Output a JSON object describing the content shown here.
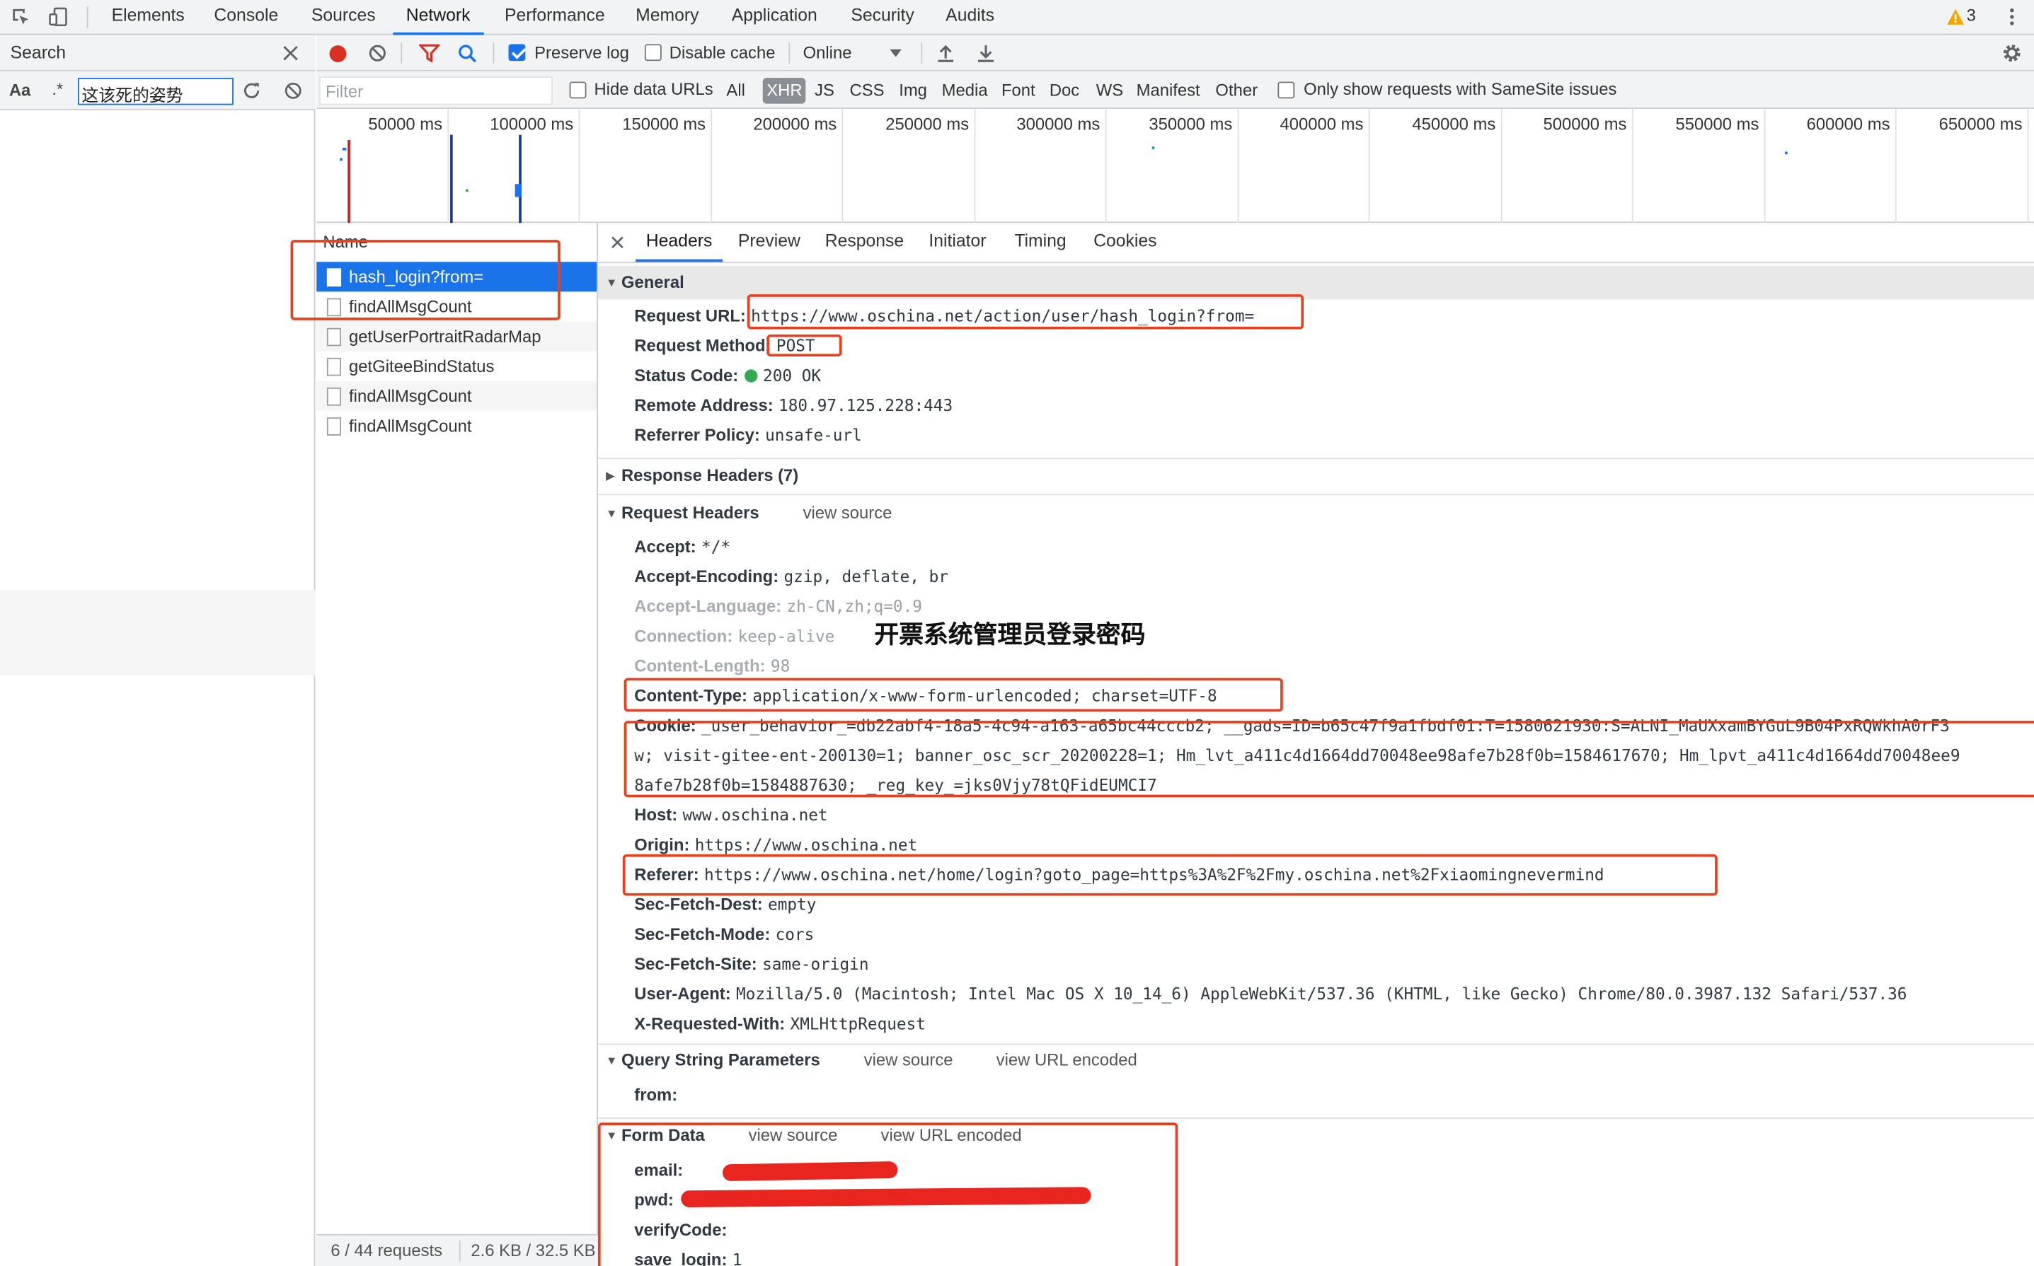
{
  "devtools": {
    "tabs": [
      "Elements",
      "Console",
      "Sources",
      "Network",
      "Performance",
      "Memory",
      "Application",
      "Security",
      "Audits"
    ],
    "active_tab": "Network",
    "warning_count": "3"
  },
  "search": {
    "title": "Search",
    "case_label": "Aa",
    "regex_label": ".*",
    "query": "这该死的姿势"
  },
  "network_toolbar": {
    "preserve_log": "Preserve log",
    "disable_cache": "Disable cache",
    "throttle": "Online"
  },
  "filter_bar": {
    "placeholder": "Filter",
    "hide_data_urls": "Hide data URLs",
    "types": [
      "All",
      "XHR",
      "JS",
      "CSS",
      "Img",
      "Media",
      "Font",
      "Doc",
      "WS",
      "Manifest",
      "Other"
    ],
    "selected_type": "XHR",
    "samesite": "Only show requests with SameSite issues"
  },
  "timeline": {
    "ticks": [
      "50000 ms",
      "100000 ms",
      "150000 ms",
      "200000 ms",
      "250000 ms",
      "300000 ms",
      "350000 ms",
      "400000 ms",
      "450000 ms",
      "500000 ms",
      "550000 ms",
      "600000 ms",
      "650000 ms"
    ]
  },
  "requests": {
    "header": "Name",
    "items": [
      "hash_login?from=",
      "findAllMsgCount",
      "getUserPortraitRadarMap",
      "getGiteeBindStatus",
      "findAllMsgCount",
      "findAllMsgCount"
    ],
    "status_count": "6 / 44 requests",
    "status_size": "2.6 KB / 32.5 KB"
  },
  "detail": {
    "tabs": [
      "Headers",
      "Preview",
      "Response",
      "Initiator",
      "Timing",
      "Cookies"
    ],
    "active_tab": "Headers",
    "general": {
      "title": "General",
      "request_url_k": "Request URL:",
      "request_url_v": "https://www.oschina.net/action/user/hash_login?from=",
      "method_k": "Request Method:",
      "method_v": "POST",
      "status_k": "Status Code:",
      "status_v": "200 OK",
      "remote_k": "Remote Address:",
      "remote_v": "180.97.125.228:443",
      "referrer_k": "Referrer Policy:",
      "referrer_v": "unsafe-url"
    },
    "response_headers": "Response Headers (7)",
    "request_headers": {
      "title": "Request Headers",
      "view_source": "view source",
      "accept_k": "Accept:",
      "accept_v": "*/*",
      "encoding_k": "Accept-Encoding:",
      "encoding_v": "gzip, deflate, br",
      "language_k": "Accept-Language:",
      "language_v": "zh-CN,zh;q=0.9",
      "connection_k": "Connection:",
      "connection_v": "keep-alive",
      "length_k": "Content-Length:",
      "length_v": "98",
      "ctype_k": "Content-Type:",
      "ctype_v": "application/x-www-form-urlencoded; charset=UTF-8",
      "cookie_k": "Cookie:",
      "cookie_v1": "_user_behavior_=db22abf4-18a5-4c94-a163-a65bc44cccb2; __gads=ID=b65c47f9a1fbdf01:T=1580621930:S=ALNI_MaUXxamBYGuL9B04PxRQWkhA0rF3",
      "cookie_v2": "w; visit-gitee-ent-200130=1; banner_osc_scr_20200228=1; Hm_lvt_a411c4d1664dd70048ee98afe7b28f0b=1584617670; Hm_lpvt_a411c4d1664dd70048ee9",
      "cookie_v3": "8afe7b28f0b=1584887630; _reg_key_=jks0Vjy78tQFidEUMCI7",
      "host_k": "Host:",
      "host_v": "www.oschina.net",
      "origin_k": "Origin:",
      "origin_v": "https://www.oschina.net",
      "referer_k": "Referer:",
      "referer_v": "https://www.oschina.net/home/login?goto_page=https%3A%2F%2Fmy.oschina.net%2Fxiaomingnevermind",
      "dest_k": "Sec-Fetch-Dest:",
      "dest_v": "empty",
      "mode_k": "Sec-Fetch-Mode:",
      "mode_v": "cors",
      "site_k": "Sec-Fetch-Site:",
      "site_v": "same-origin",
      "ua_k": "User-Agent:",
      "ua_v": "Mozilla/5.0 (Macintosh; Intel Mac OS X 10_14_6) AppleWebKit/537.36 (KHTML, like Gecko) Chrome/80.0.3987.132 Safari/537.36",
      "xrw_k": "X-Requested-With:",
      "xrw_v": "XMLHttpRequest"
    },
    "annotation": "开票系统管理员登录密码",
    "query_string": {
      "title": "Query String Parameters",
      "view_source": "view source",
      "view_url": "view URL encoded",
      "from_k": "from:"
    },
    "form_data": {
      "title": "Form Data",
      "view_source": "view source",
      "view_url": "view URL encoded",
      "email_k": "email:",
      "pwd_k": "pwd:",
      "verify_k": "verifyCode:",
      "save_k": "save_login:",
      "save_v": "1"
    }
  },
  "colors": {
    "accent": "#1a73e8",
    "annotation_red": "#e8401e",
    "record_red": "#d93025",
    "status_green": "#34a853"
  }
}
